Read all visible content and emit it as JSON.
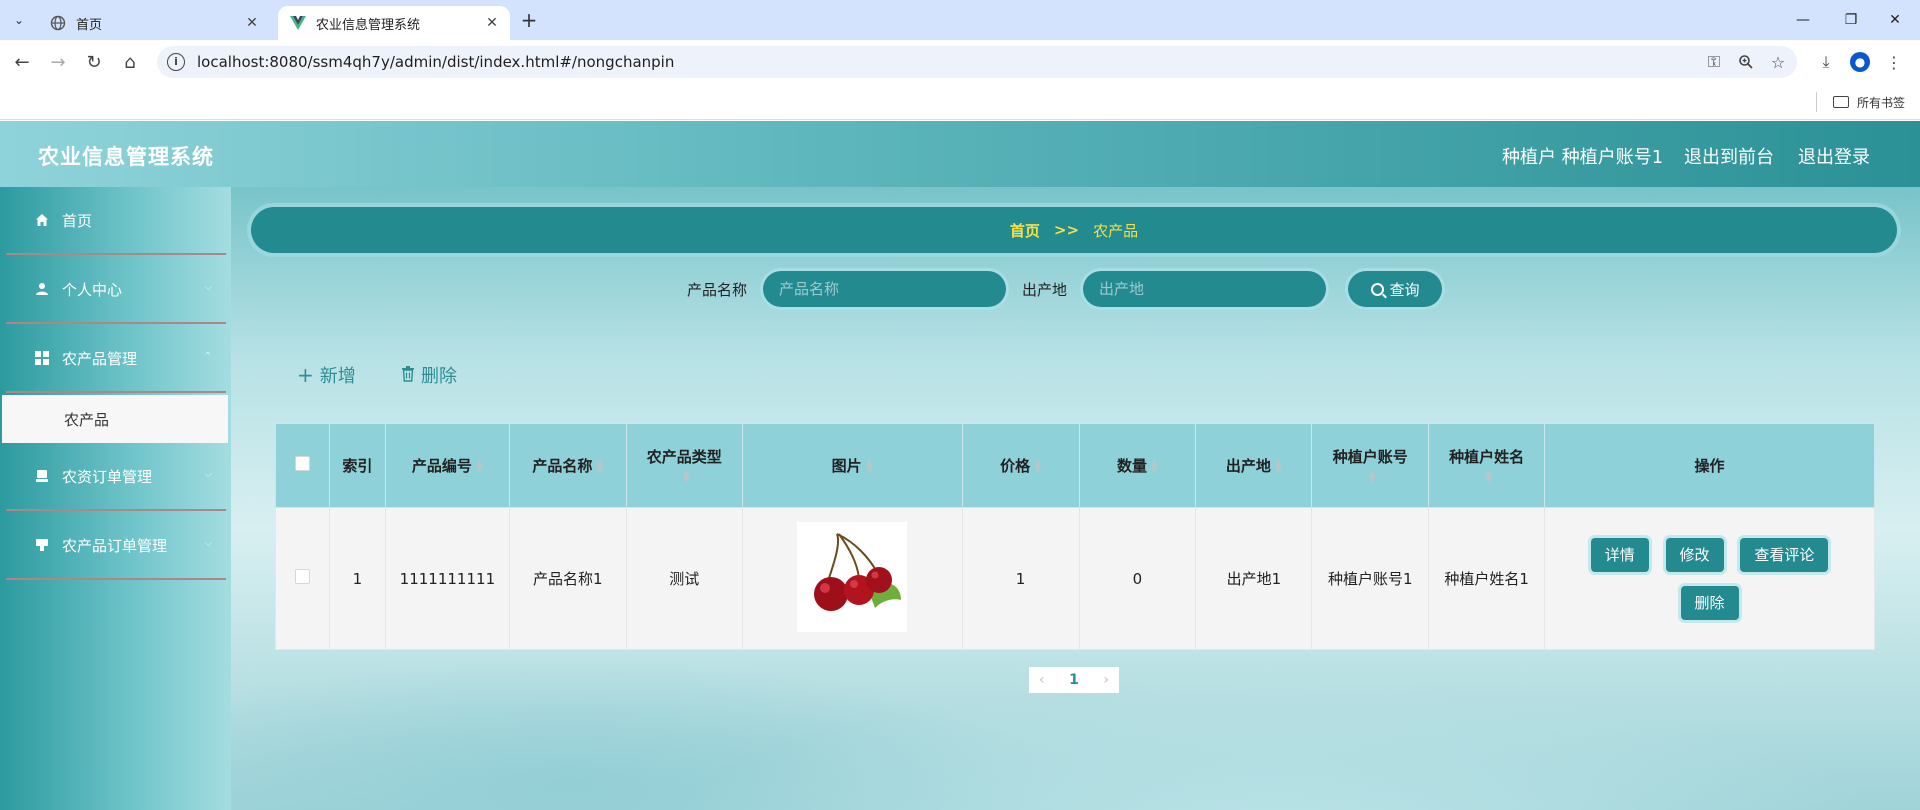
{
  "browser": {
    "tabs": [
      {
        "title": "首页",
        "active": false
      },
      {
        "title": "农业信息管理系统",
        "active": true
      }
    ],
    "url": "localhost:8080/ssm4qh7y/admin/dist/index.html#/nongchanpin",
    "bookmarks_all": "所有书签"
  },
  "app": {
    "brand": "农业信息管理系统",
    "header_user": "种植户 种植户账号1",
    "header_front": "退出到前台",
    "header_logout": "退出登录"
  },
  "sidebar": {
    "items": [
      {
        "label": "首页",
        "icon": "home-icon"
      },
      {
        "label": "个人中心",
        "icon": "user-icon"
      },
      {
        "label": "农产品管理",
        "icon": "grid-icon"
      },
      {
        "label": "农产品",
        "icon": ""
      },
      {
        "label": "农资订单管理",
        "icon": "order-icon"
      },
      {
        "label": "农产品订单管理",
        "icon": "order2-icon"
      }
    ]
  },
  "breadcrumb": {
    "home": "首页",
    "separator": ">>",
    "current": "农产品"
  },
  "search": {
    "name_label": "产品名称",
    "name_placeholder": "产品名称",
    "origin_label": "出产地",
    "origin_placeholder": "出产地",
    "button": "查询"
  },
  "actions": {
    "add": "新增",
    "delete": "删除"
  },
  "table": {
    "headers": [
      "索引",
      "产品编号",
      "产品名称",
      "农产品类型",
      "图片",
      "价格",
      "数量",
      "出产地",
      "种植户账号",
      "种植户姓名",
      "操作"
    ],
    "rows": [
      {
        "index": "1",
        "code": "1111111111",
        "name": "产品名称1",
        "type": "测试",
        "image": "cherries",
        "price": "1",
        "quantity": "0",
        "origin": "出产地1",
        "account": "种植户账号1",
        "farmer": "种植户姓名1",
        "ops": [
          "详情",
          "修改",
          "查看评论",
          "删除"
        ]
      }
    ]
  },
  "pager": {
    "current": "1"
  },
  "colors": {
    "primary": "#238b90",
    "crumb_text": "#f6e04a"
  }
}
